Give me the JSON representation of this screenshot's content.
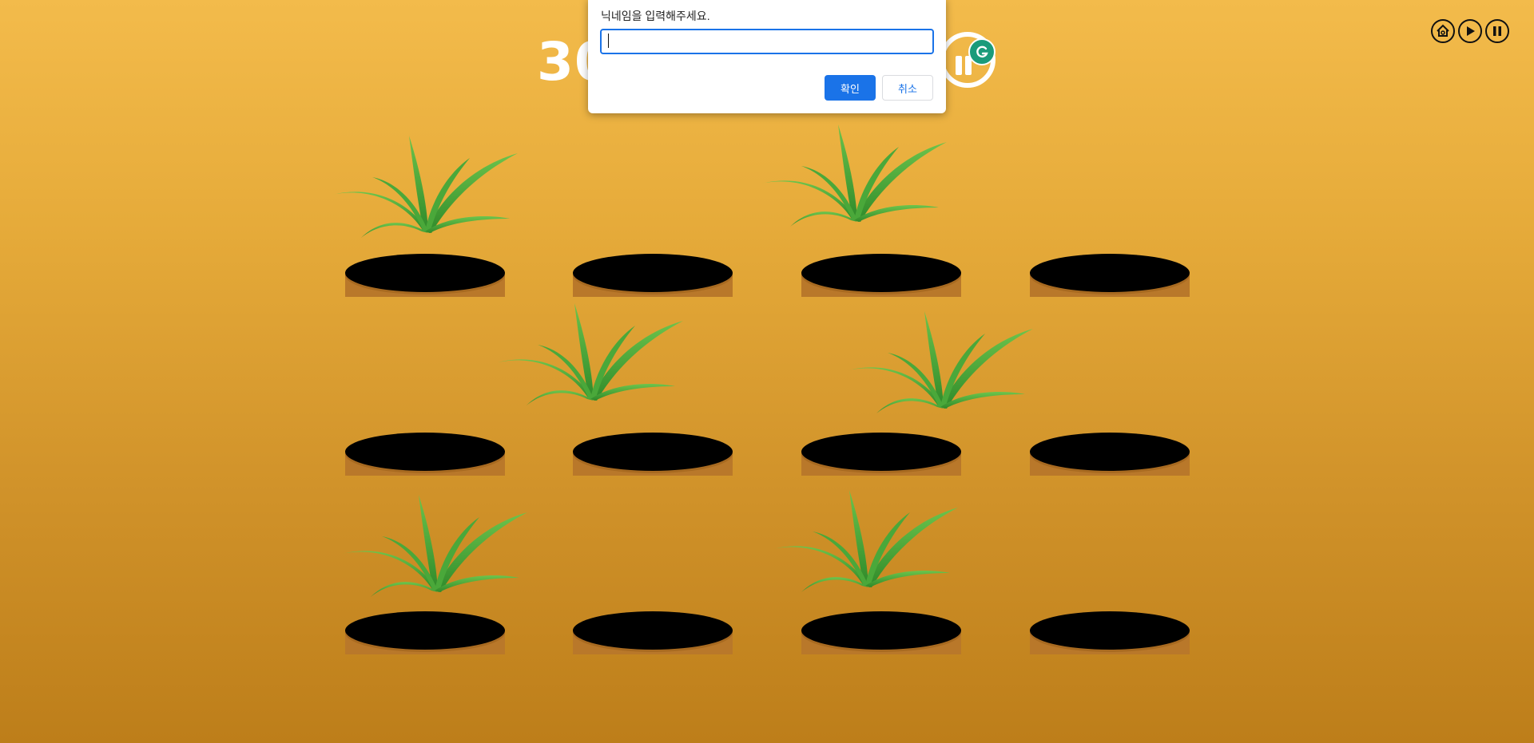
{
  "controls": [
    {
      "name": "home-button",
      "icon": "home-icon"
    },
    {
      "name": "play-button",
      "icon": "play-icon"
    },
    {
      "name": "pause-button",
      "icon": "pause-icon"
    }
  ],
  "score": "30",
  "dialog": {
    "message": "닉네임을 입력해주세요.",
    "input_value": "",
    "ok_label": "확인",
    "cancel_label": "취소"
  },
  "board": {
    "rows": 3,
    "cols": 4,
    "grass_positions": [
      {
        "row": 0,
        "col": 0
      },
      {
        "row": 0,
        "col": 2
      },
      {
        "row": 1,
        "col": 1
      },
      {
        "row": 1,
        "col": 2
      },
      {
        "row": 2,
        "col": 0
      },
      {
        "row": 2,
        "col": 2
      }
    ]
  },
  "colors": {
    "background_top": "#f3bb4b",
    "background_bottom": "#bd7e1a",
    "hole": "#000000",
    "dirt": "#b9782a",
    "grass": "#4aa83a",
    "dialog_accent": "#1a73e8"
  }
}
